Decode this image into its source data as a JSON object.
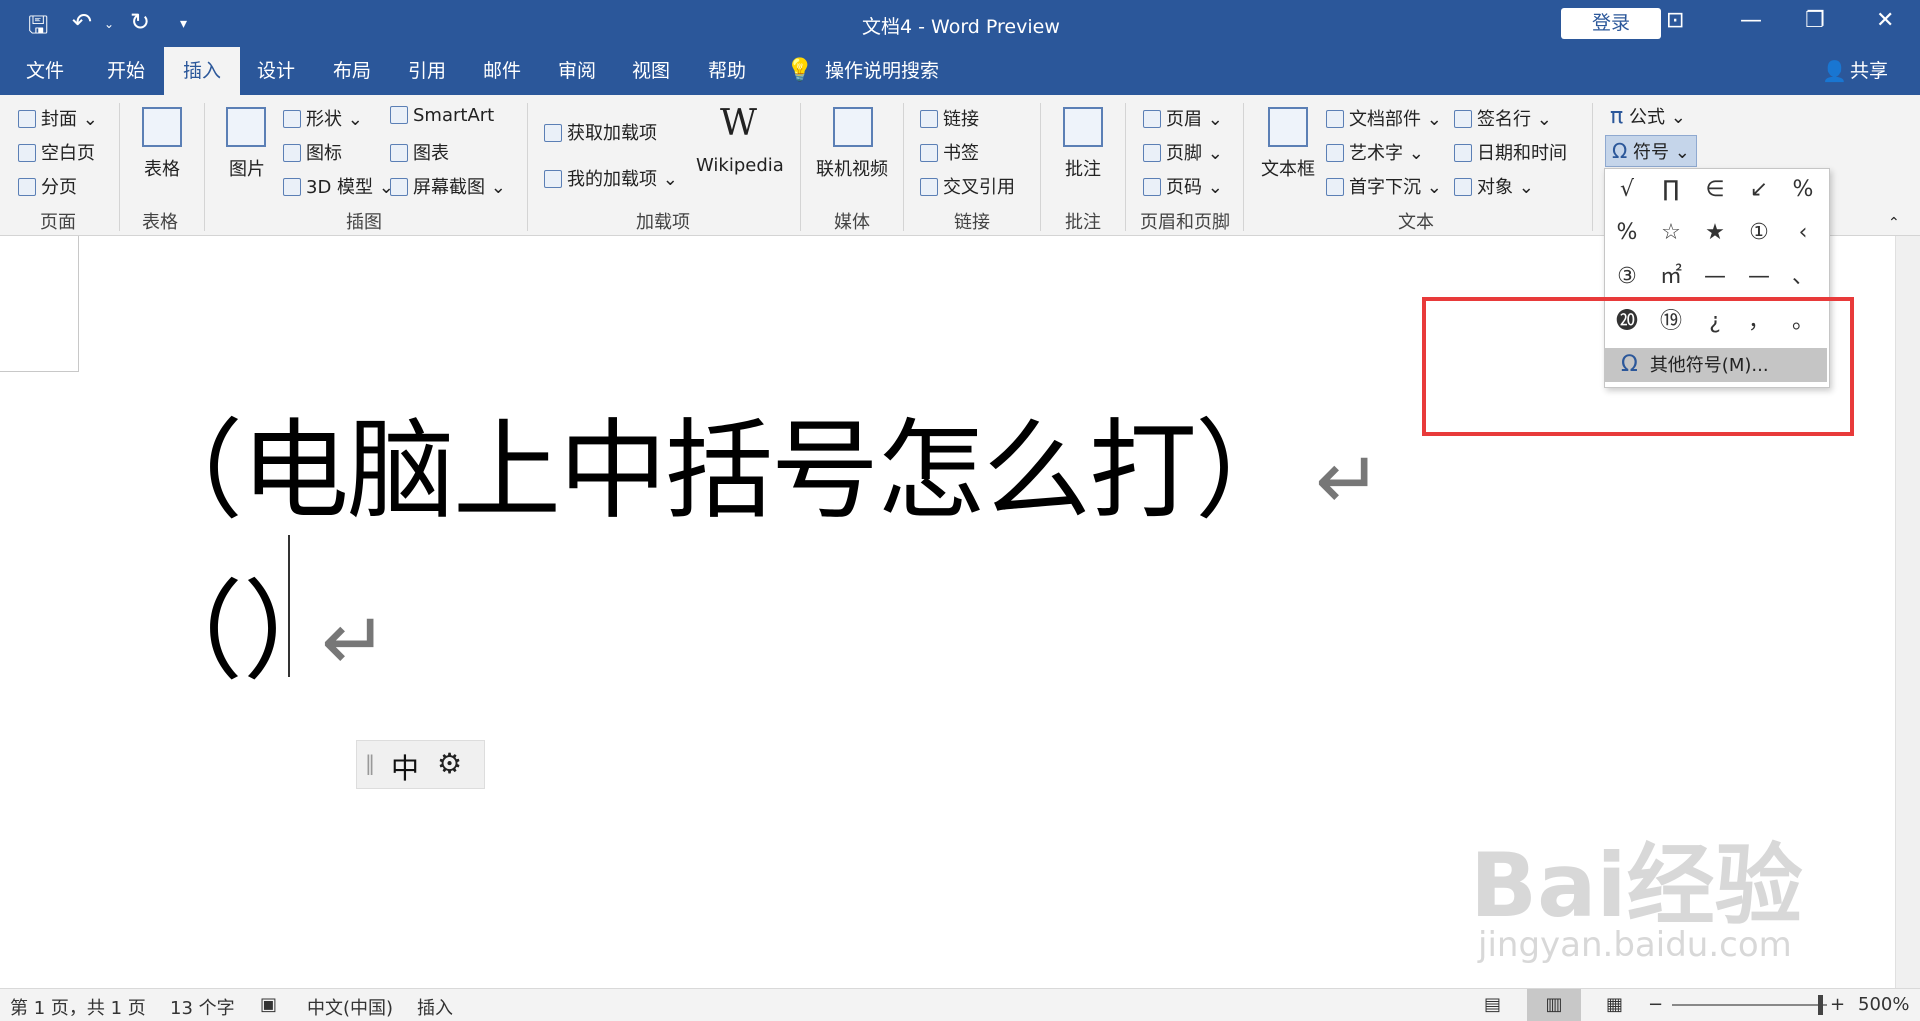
{
  "window": {
    "title": "文档4  -  Word Preview",
    "login": "登录",
    "share": "共享"
  },
  "tabs": [
    "文件",
    "开始",
    "插入",
    "设计",
    "布局",
    "引用",
    "邮件",
    "审阅",
    "视图",
    "帮助"
  ],
  "tell_me": "操作说明搜索",
  "ribbon": {
    "pages": {
      "cover": "封面",
      "blank": "空白页",
      "break": "分页",
      "label": "页面"
    },
    "tables": {
      "table": "表格",
      "label": "表格"
    },
    "illustrations": {
      "picture": "图片",
      "shapes": "形状",
      "icons": "图标",
      "model3d": "3D 模型",
      "smartart": "SmartArt",
      "chart": "图表",
      "screenshot": "屏幕截图",
      "label": "插图"
    },
    "addins": {
      "get": "获取加载项",
      "my": "我的加载项",
      "wikipedia": "Wikipedia",
      "label": "加载项"
    },
    "media": {
      "video": "联机视频",
      "label": "媒体"
    },
    "links": {
      "link": "链接",
      "bookmark": "书签",
      "crossref": "交叉引用",
      "label": "链接"
    },
    "comments": {
      "comment": "批注",
      "label": "批注"
    },
    "header_footer": {
      "header": "页眉",
      "footer": "页脚",
      "pagenum": "页码",
      "label": "页眉和页脚"
    },
    "text": {
      "textbox": "文本框",
      "quickparts": "文档部件",
      "wordart": "艺术字",
      "dropcap": "首字下沉",
      "signature": "签名行",
      "datetime": "日期和时间",
      "object": "对象",
      "label": "文本"
    },
    "symbols": {
      "equation": "公式",
      "symbol": "符号"
    }
  },
  "symbol_grid": [
    [
      "√",
      "∏",
      "∈",
      "↙",
      "%"
    ],
    [
      "%",
      "☆",
      "★",
      "①",
      "‹"
    ],
    [
      "③",
      "㎡",
      "—",
      "—",
      "、"
    ],
    [
      "⓴",
      "⑲",
      "¿",
      "，",
      "。"
    ]
  ],
  "more_symbols": "其他符号(M)...",
  "document": {
    "line1": "（电脑上中括号怎么打）",
    "line2": "（）",
    "para_mark": "↵",
    "ime_mode": "中"
  },
  "watermark": {
    "brand": "Bai经验",
    "url": "jingyan.baidu.com"
  },
  "status": {
    "page": "第 1 页，共 1 页",
    "words": "13 个字",
    "lang": "中文(中国)",
    "mode": "插入",
    "zoom": "500%"
  }
}
